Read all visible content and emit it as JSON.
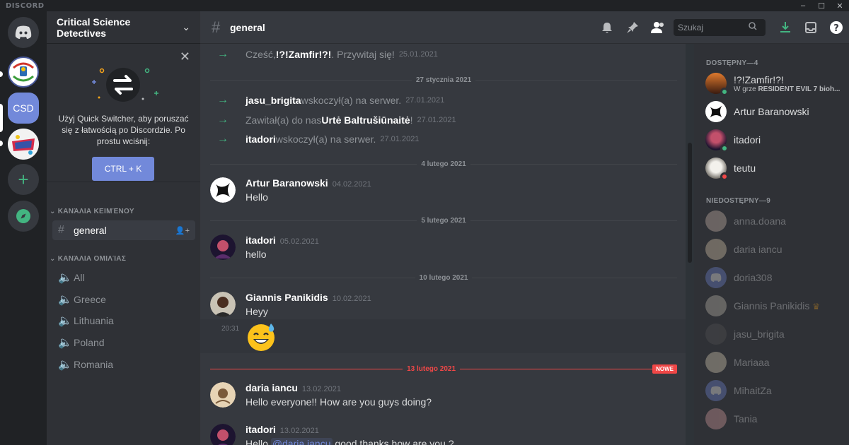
{
  "app": {
    "logo": "DISCORD"
  },
  "window_controls": [
    "–",
    "☐",
    "✕"
  ],
  "servers": {
    "csd_label": "CSD"
  },
  "guild": {
    "name": "Critical Science Detectives"
  },
  "quick_switcher": {
    "text": "Użyj Quick Switcher, aby poruszać się z łatwością po Discordzie. Po prostu wciśnij:",
    "button": "CTRL + K"
  },
  "channels": {
    "text_category": "ΚΑΝΆΛΙΑ ΚΕΙΜΈΝΟΥ",
    "text": [
      {
        "name": "general"
      }
    ],
    "voice_category": "ΚΑΝΆΛΙΑ ΟΜΙΛΊΑΣ",
    "voice": [
      {
        "name": "All"
      },
      {
        "name": "Greece"
      },
      {
        "name": "Lithuania"
      },
      {
        "name": "Poland"
      },
      {
        "name": "Romania"
      }
    ]
  },
  "header": {
    "channel": "general",
    "search_placeholder": "Szukaj"
  },
  "messages": {
    "sys0": {
      "pre": "Cześć, ",
      "name": "!?!Zamfir!?!",
      "post": ". Przywitaj się!",
      "ts": "25.01.2021"
    },
    "div1": "27 stycznia 2021",
    "sys1": {
      "name": "jasu_brigita",
      "post": " wskoczył(a) na serwer.",
      "ts": "27.01.2021"
    },
    "sys2": {
      "pre": "Zawitał(a) do nas ",
      "name": "Urtė Baltrušiūnaitė",
      "post": "!",
      "ts": "27.01.2021"
    },
    "sys3": {
      "name": "itadori",
      "post": " wskoczył(a) na serwer.",
      "ts": "27.01.2021"
    },
    "div2": "4 lutego 2021",
    "m1": {
      "author": "Artur Baranowski",
      "date": "04.02.2021",
      "text": "Hello"
    },
    "div3": "5 lutego 2021",
    "m2": {
      "author": "itadori",
      "date": "05.02.2021",
      "text": "hello"
    },
    "div4": "10 lutego 2021",
    "m3": {
      "author": "Giannis Panikidis",
      "date": "10.02.2021",
      "text": "Heyy",
      "followup_ts": "20:31"
    },
    "div_new": "13 lutego 2021",
    "new_tag": "NOWE",
    "m4": {
      "author": "daria iancu",
      "date": "13.02.2021",
      "text": "Hello everyone!! How are you guys doing?"
    },
    "m5": {
      "author": "itadori",
      "date": "13.02.2021",
      "pre": "Hello ",
      "mention": "@daria iancu",
      "post": " good thanks how are you ?"
    }
  },
  "members": {
    "online_header": "DOSTĘPNY—4",
    "online": [
      {
        "name": "!?!Zamfir!?!",
        "activity_pre": "W grze ",
        "activity_game": "RESIDENT EVIL 7 bioh..."
      },
      {
        "name": "Artur Baranowski"
      },
      {
        "name": "itadori"
      },
      {
        "name": "teutu"
      }
    ],
    "offline_header": "NIEDOSTĘPNY—9",
    "offline": [
      {
        "name": "anna.doana"
      },
      {
        "name": "daria iancu"
      },
      {
        "name": "doria308"
      },
      {
        "name": "Giannis Panikidis"
      },
      {
        "name": "jasu_brigita"
      },
      {
        "name": "Mariaaa"
      },
      {
        "name": "MihaitZa"
      },
      {
        "name": "Tania"
      }
    ]
  },
  "colors": {
    "accent": "#7289da",
    "online": "#43b581",
    "dnd": "#f04747",
    "new_divider": "#f04747"
  }
}
